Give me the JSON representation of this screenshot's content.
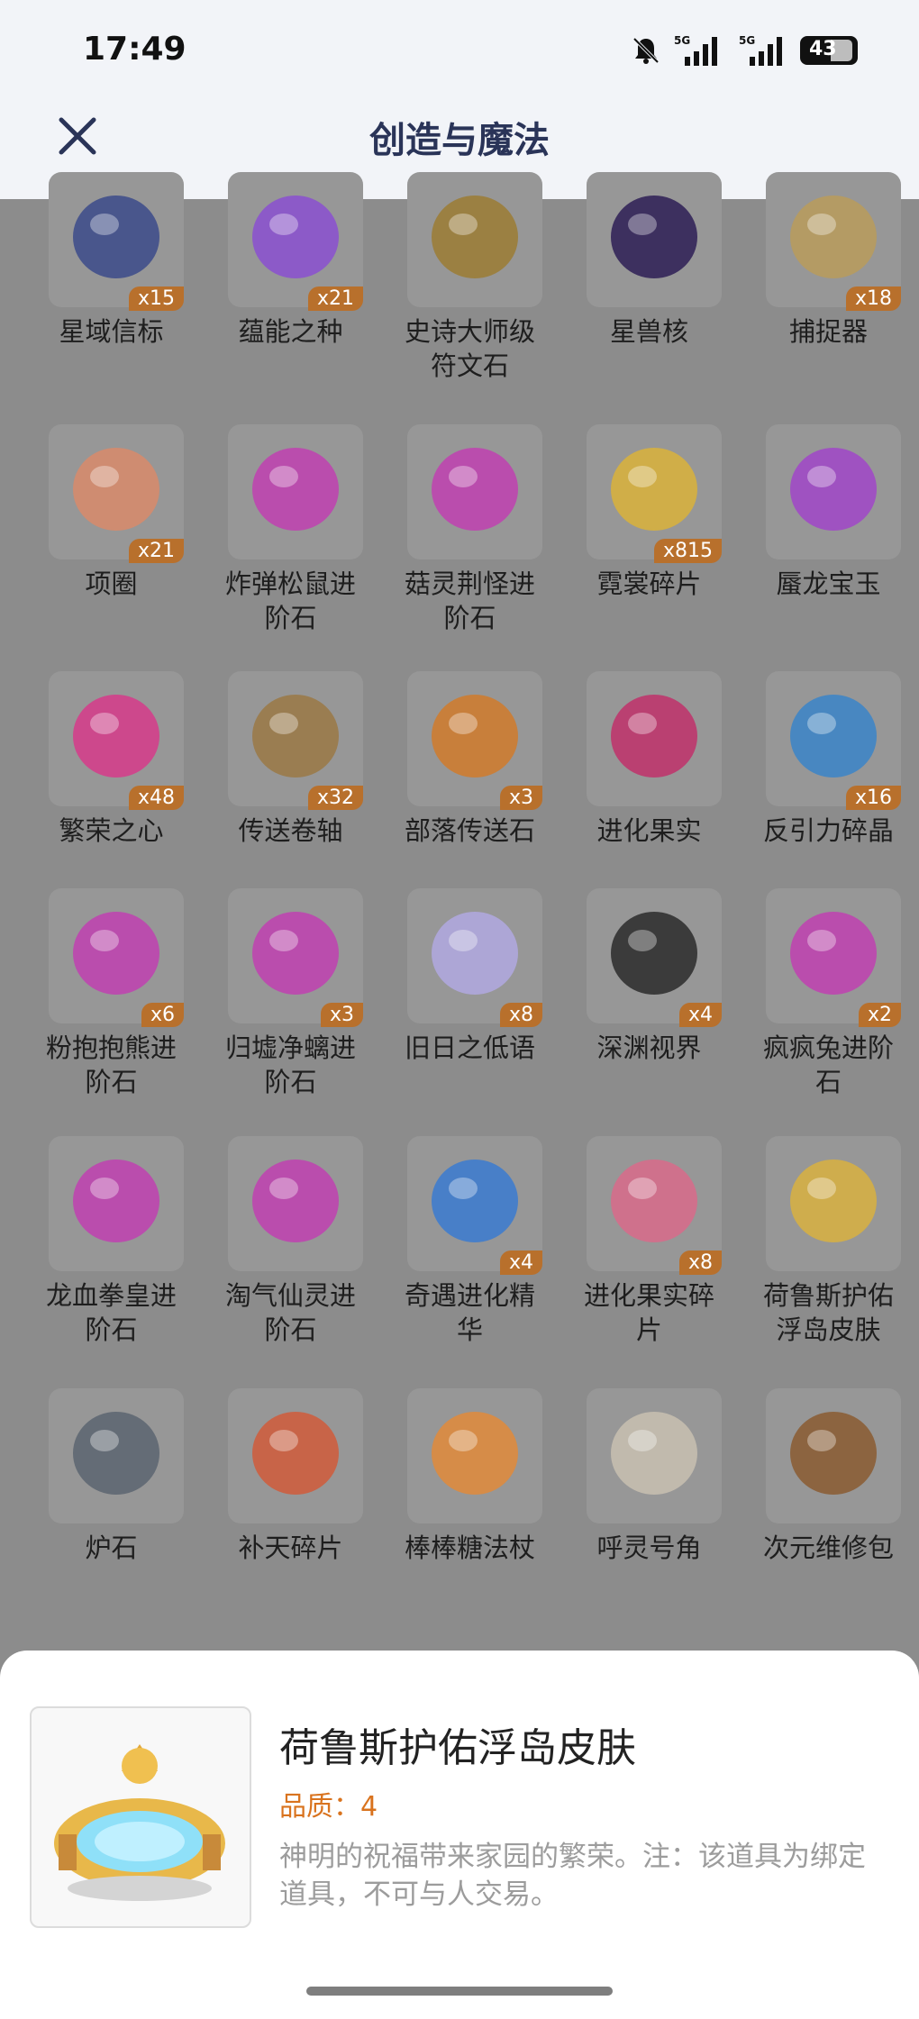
{
  "status_bar": {
    "time": "17:49",
    "battery": "43"
  },
  "header": {
    "title": "创造与魔法",
    "close_icon": "close-icon"
  },
  "items": [
    {
      "label": "星域信标",
      "qty": "x15",
      "icon": "star-beacon-icon",
      "color": "#3b4a8a"
    },
    {
      "label": "蕴能之种",
      "qty": "x21",
      "icon": "purple-crystal-icon",
      "color": "#8a4fd0"
    },
    {
      "label": "史诗大师级\n符文石",
      "qty": "",
      "icon": "rune-stone-icon",
      "color": "#9b7b33"
    },
    {
      "label": "星兽核",
      "qty": "",
      "icon": "star-beast-core-icon",
      "color": "#2d1d55"
    },
    {
      "label": "捕捉器",
      "qty": "x18",
      "icon": "thorn-ring-icon",
      "color": "#b89b5a"
    },
    {
      "label": "项圈",
      "qty": "x21",
      "icon": "collar-icon",
      "color": "#d88a6a"
    },
    {
      "label": "炸弹松鼠进\n阶石",
      "qty": "",
      "icon": "gem-acorn-icon",
      "color": "#c040b0"
    },
    {
      "label": "菇灵荆怪进\n阶石",
      "qty": "",
      "icon": "gem-mushroom-icon",
      "color": "#c040b0"
    },
    {
      "label": "霓裳碎片",
      "qty": "x815",
      "icon": "shirt-icon",
      "color": "#d9b13a"
    },
    {
      "label": "蜃龙宝玉",
      "qty": "",
      "icon": "dragon-jade-icon",
      "color": "#a045c8"
    },
    {
      "label": "繁荣之心",
      "qty": "x48",
      "icon": "pink-heart-gem-icon",
      "color": "#d63a8a"
    },
    {
      "label": "传送卷轴",
      "qty": "x32",
      "icon": "scroll-icon",
      "color": "#9a7844"
    },
    {
      "label": "部落传送石",
      "qty": "x3",
      "icon": "tribe-stone-icon",
      "color": "#d07a2a"
    },
    {
      "label": "进化果实",
      "qty": "",
      "icon": "evolution-fruit-icon",
      "color": "#c0306a"
    },
    {
      "label": "反引力碎晶",
      "qty": "x16",
      "icon": "anti-gravity-crystal-icon",
      "color": "#3a84c8"
    },
    {
      "label": "粉抱抱熊进\n阶石",
      "qty": "x6",
      "icon": "gem-egg-icon",
      "color": "#c040b0"
    },
    {
      "label": "归墟净螭进\n阶石",
      "qty": "x3",
      "icon": "gem-wave-icon",
      "color": "#c040b0"
    },
    {
      "label": "旧日之低语",
      "qty": "x8",
      "icon": "whisper-orb-icon",
      "color": "#b0a8e0"
    },
    {
      "label": "深渊视界",
      "qty": "x4",
      "icon": "abyss-eye-icon",
      "color": "#2a2a2a"
    },
    {
      "label": "疯疯兔进阶\n石",
      "qty": "x2",
      "icon": "gem-carrot-icon",
      "color": "#c040b0"
    },
    {
      "label": "龙血拳皇进\n阶石",
      "qty": "",
      "icon": "gem-horn-icon",
      "color": "#c040b0"
    },
    {
      "label": "淘气仙灵进\n阶石",
      "qty": "",
      "icon": "gem-fairy-icon",
      "color": "#c040b0"
    },
    {
      "label": "奇遇进化精\n华",
      "qty": "x4",
      "icon": "essence-fruit-icon",
      "color": "#3a7ad0"
    },
    {
      "label": "进化果实碎\n片",
      "qty": "x8",
      "icon": "fruit-slice-icon",
      "color": "#d86a8a"
    },
    {
      "label": "荷鲁斯护佑\n浮岛皮肤",
      "qty": "",
      "icon": "floating-island-icon",
      "color": "#d8b040"
    },
    {
      "label": "炉石",
      "qty": "",
      "icon": "hearthstone-icon",
      "color": "#5a6470"
    },
    {
      "label": "补天碎片",
      "qty": "",
      "icon": "feather-shards-icon",
      "color": "#d05a3a"
    },
    {
      "label": "棒棒糖法杖",
      "qty": "",
      "icon": "lollipop-staff-icon",
      "color": "#e08a3a"
    },
    {
      "label": "呼灵号角",
      "qty": "",
      "icon": "horn-icon",
      "color": "#c8c0b0"
    },
    {
      "label": "次元维修包",
      "qty": "",
      "icon": "repair-bag-icon",
      "color": "#8a5a30"
    }
  ],
  "detail": {
    "title": "荷鲁斯护佑浮岛皮肤",
    "quality": "品质：4",
    "description": "神明的祝福带来家园的繁荣。注：该道具为绑定道具，不可与人交易。",
    "icon": "floating-island-icon"
  }
}
